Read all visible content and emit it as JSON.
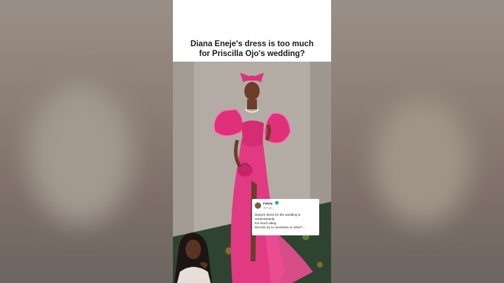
{
  "headline": {
    "line1": "Diana Eneje's dress is too much",
    "line2": "for Priscilla Ojo's wedding?"
  },
  "tweet": {
    "name": "Falola",
    "handle": "@Fola__",
    "line1": "Diana's dress for the wedding is unnecessarily",
    "line2": "too much abeg.",
    "line3": "Did she try to overdress or what?"
  },
  "colors": {
    "dress_pink": "#e0307a",
    "background_blur": "#8a7d72",
    "video_bg": "#ffffff"
  },
  "icons": {
    "verified": "verified-badge-icon",
    "emoji": "laughing-emoji-icon"
  }
}
